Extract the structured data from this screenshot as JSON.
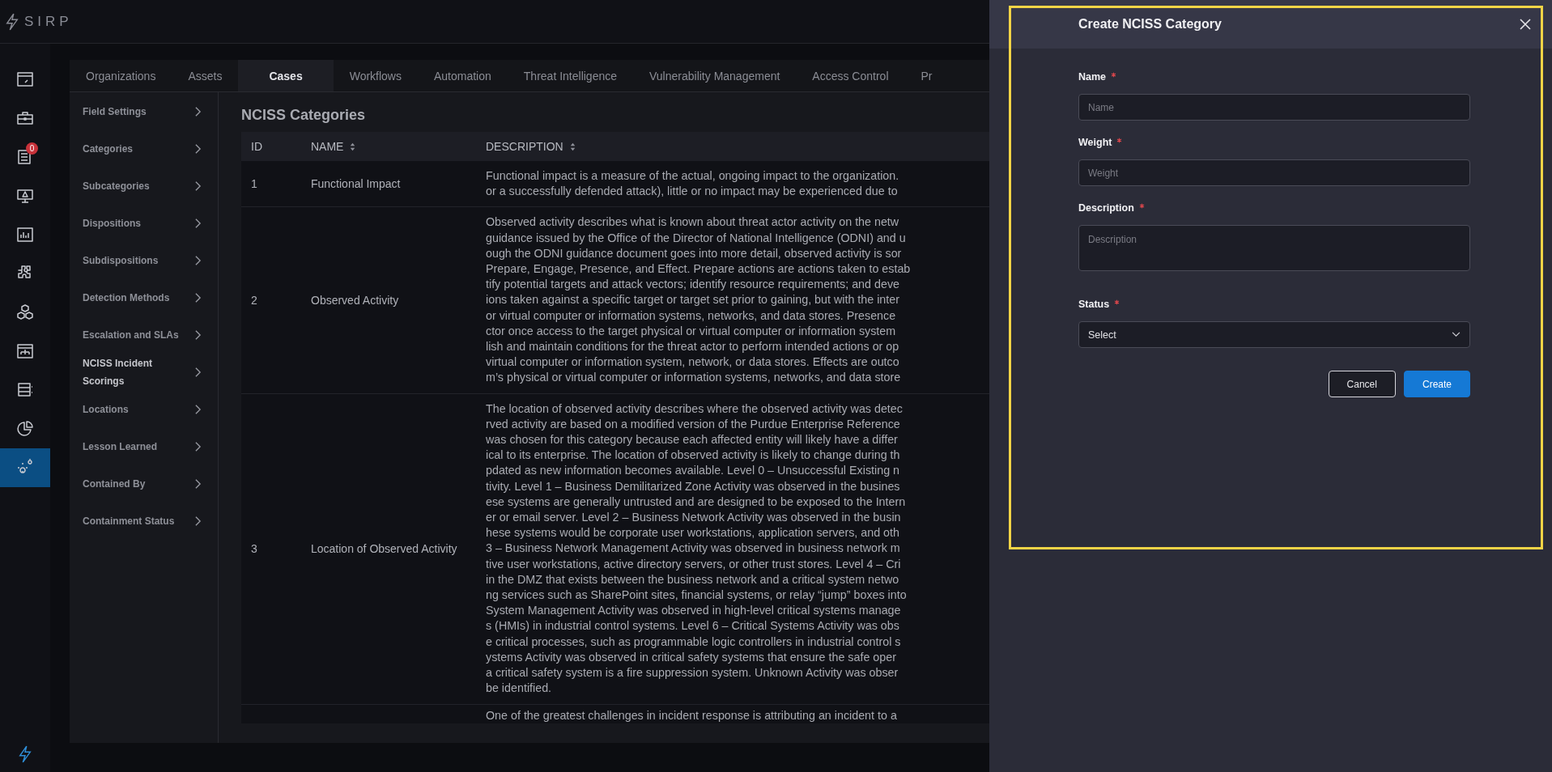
{
  "brand": {
    "logo_text": "SIRP"
  },
  "rail": [
    {
      "selected": false
    },
    {
      "selected": false
    },
    {
      "selected": false,
      "badge": "0"
    },
    {
      "selected": false
    },
    {
      "selected": false
    },
    {
      "selected": false
    },
    {
      "selected": false
    },
    {
      "selected": false
    },
    {
      "selected": false
    },
    {
      "selected": false
    },
    {
      "selected": true
    }
  ],
  "tabs": [
    {
      "label": "Organizations",
      "selected": false
    },
    {
      "label": "Assets",
      "selected": false
    },
    {
      "label": "Cases",
      "selected": true
    },
    {
      "label": "Workflows",
      "selected": false
    },
    {
      "label": "Automation",
      "selected": false
    },
    {
      "label": "Threat Intelligence",
      "selected": false
    },
    {
      "label": "Vulnerability Management",
      "selected": false
    },
    {
      "label": "Access Control",
      "selected": false
    },
    {
      "label": "Pr",
      "selected": false
    }
  ],
  "sidebar": {
    "items": [
      {
        "label": "Field Settings",
        "selected": false
      },
      {
        "label": "Categories",
        "selected": false
      },
      {
        "label": "Subcategories",
        "selected": false
      },
      {
        "label": "Dispositions",
        "selected": false
      },
      {
        "label": "Subdispositions",
        "selected": false
      },
      {
        "label": "Detection Methods",
        "selected": false
      },
      {
        "label": "Escalation and SLAs",
        "selected": false
      },
      {
        "label": "NCISS Incident Scorings",
        "selected": true
      },
      {
        "label": "Locations",
        "selected": false
      },
      {
        "label": "Lesson Learned",
        "selected": false
      },
      {
        "label": "Contained By",
        "selected": false
      },
      {
        "label": "Containment Status",
        "selected": false
      }
    ]
  },
  "page_title": "NCISS Categories",
  "table": {
    "columns": [
      {
        "label": "ID",
        "sortable": false
      },
      {
        "label": "NAME",
        "sortable": true
      },
      {
        "label": "DESCRIPTION",
        "sortable": true
      }
    ],
    "rows": [
      {
        "id": "1",
        "name": "Functional Impact",
        "description_lines": [
          "Functional impact is a measure of the actual, ongoing impact to the organization.",
          "or a successfully defended attack), little or no impact may be experienced due to"
        ]
      },
      {
        "id": "2",
        "name": "Observed Activity",
        "description_lines": [
          "Observed activity describes what is known about threat actor activity on the netw",
          "guidance issued by the Office of the Director of National Intelligence (ODNI) and u",
          "ough the ODNI guidance document goes into more detail, observed activity is sor",
          "Prepare, Engage, Presence, and Effect. Prepare actions are actions taken to estab",
          "tify potential targets and attack vectors; identify resource requirements; and deve",
          "ions taken against a specific target or target set prior to gaining, but with the inter",
          "or virtual computer or information systems, networks, and data stores. Presence",
          "ctor once access to the target physical or virtual computer or information system",
          "lish and maintain conditions for the threat actor to perform intended actions or op",
          "virtual computer or information system, network, or data stores. Effects are outco",
          "m’s physical or virtual computer or information systems, networks, and data store"
        ]
      },
      {
        "id": "3",
        "name": "Location of Observed Activity",
        "description_lines": [
          "The location of observed activity describes where the observed activity was detec",
          "rved activity are based on a modified version of the Purdue Enterprise Reference",
          "was chosen for this category because each affected entity will likely have a differ",
          "ical to its enterprise. The location of observed activity is likely to change during th",
          "pdated as new information becomes available. Level 0 – Unsuccessful Existing n",
          "tivity. Level 1 – Business Demilitarized Zone Activity was observed in the busines",
          "ese systems are generally untrusted and are designed to be exposed to the Intern",
          "er or email server. Level 2 – Business Network Activity was observed in the busin",
          "hese systems would be corporate user workstations, application servers, and oth",
          "3 – Business Network Management Activity was observed in business network m",
          "tive user workstations, active directory servers, or other trust stores. Level 4 – Cri",
          "in the DMZ that exists between the business network and a critical system netwo",
          "ng services such as SharePoint sites, financial systems, or relay “jump” boxes into",
          "System Management Activity was observed in high-level critical systems manage",
          "s (HMIs) in industrial control systems. Level 6 – Critical Systems Activity was obs",
          "e critical processes, such as programmable logic controllers in industrial control s",
          "ystems Activity was observed in critical safety systems that ensure the safe oper",
          "a critical safety system is a fire suppression system. Unknown Activity was obser",
          "be identified."
        ]
      },
      {
        "description_lines": [
          "One of the greatest challenges in incident response is attributing an incident to a"
        ]
      }
    ]
  },
  "drawer": {
    "title": "Create NCISS Category",
    "fields": [
      {
        "kind": "input",
        "label": "Name",
        "required": true,
        "placeholder": "Name"
      },
      {
        "kind": "input",
        "label": "Weight",
        "required": true,
        "placeholder": "Weight"
      },
      {
        "kind": "textarea",
        "label": "Description",
        "required": true,
        "placeholder": "Description"
      },
      {
        "kind": "select",
        "label": "Status",
        "required": true,
        "value": "Select"
      }
    ],
    "buttons": [
      {
        "label": "Cancel",
        "kind": "secondary"
      },
      {
        "label": "Create",
        "kind": "primary"
      }
    ]
  }
}
